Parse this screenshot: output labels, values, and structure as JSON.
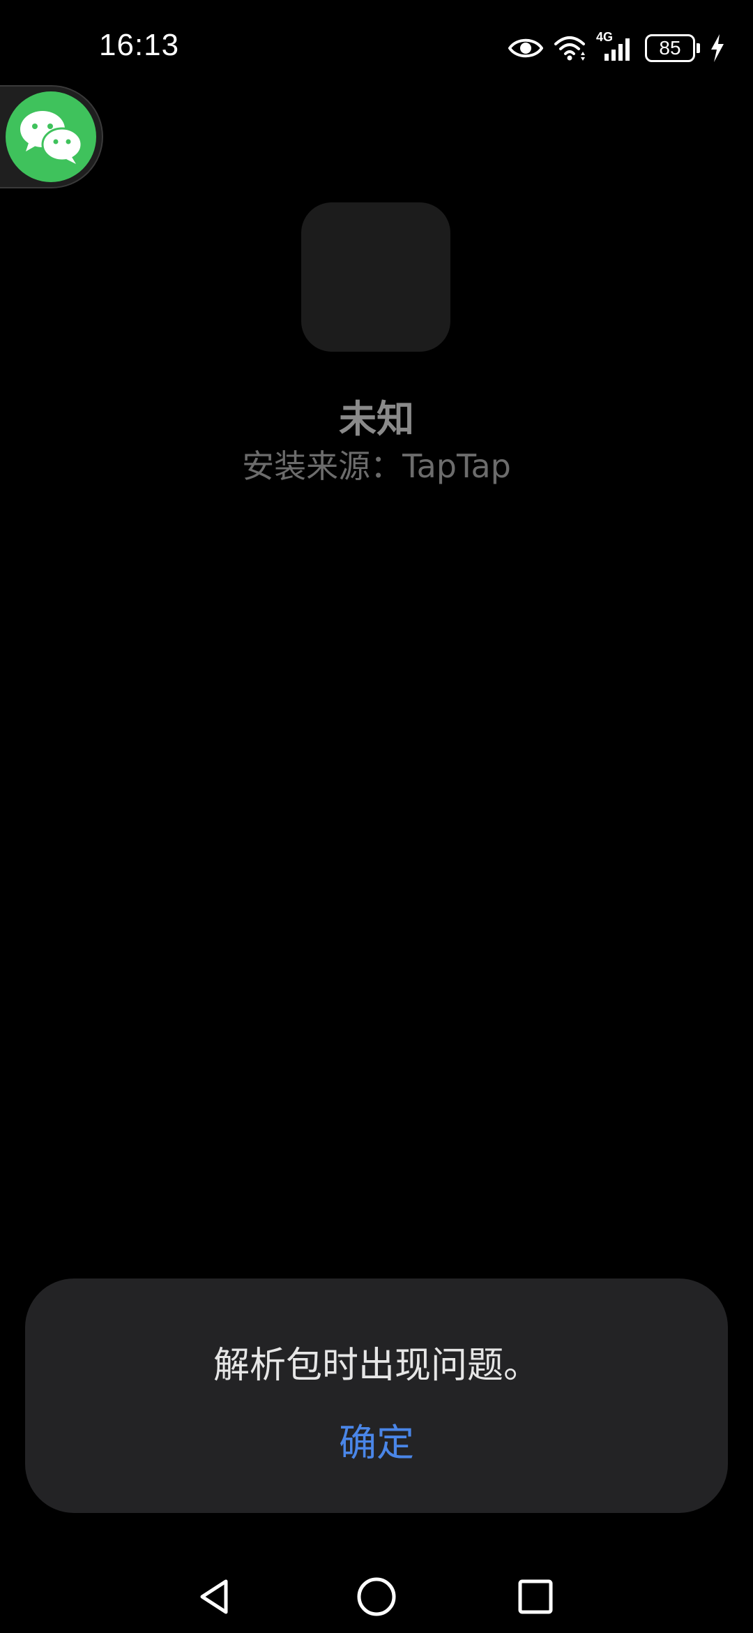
{
  "status_bar": {
    "time": "16:13",
    "network": "4G",
    "battery_level": "85",
    "icons": [
      "eye-icon",
      "wifi-icon",
      "cellular-signal-icon",
      "battery-icon",
      "charging-bolt-icon"
    ]
  },
  "floating_bubble": {
    "icon": "wechat-icon",
    "color": "#3fc25c"
  },
  "app": {
    "name": "未知",
    "install_source": "安装来源：TapTap"
  },
  "dialog": {
    "message": "解析包时出现问题。",
    "confirm_label": "确定",
    "accent_color": "#4a86e8"
  },
  "nav_bar": {
    "icons": [
      "back-triangle-icon",
      "home-circle-icon",
      "recents-square-icon"
    ]
  }
}
